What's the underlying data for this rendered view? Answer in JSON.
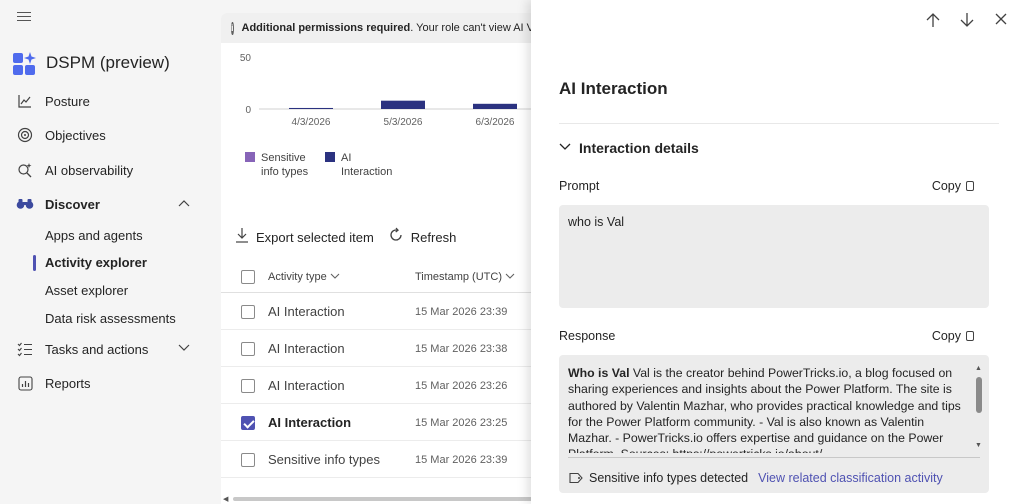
{
  "app": {
    "title": "DSPM (preview)",
    "brand_color": "#4f52b2"
  },
  "nav": {
    "items": [
      {
        "label": "Posture",
        "icon": "trend-chart-icon"
      },
      {
        "label": "Objectives",
        "icon": "target-icon"
      },
      {
        "label": "AI observability",
        "icon": "search-sparkle-icon"
      },
      {
        "label": "Discover",
        "icon": "binoculars-icon"
      },
      {
        "label": "Tasks and actions",
        "icon": "task-list-icon"
      },
      {
        "label": "Reports",
        "icon": "report-icon"
      }
    ],
    "discover_children": [
      "Apps and agents",
      "Activity explorer",
      "Asset explorer",
      "Data risk assessments"
    ],
    "active_child": "Activity explorer"
  },
  "banner": {
    "bold": "Additional permissions required",
    "text": ". Your role can't view AI Visi"
  },
  "chart_data": {
    "type": "bar",
    "categories": [
      "4/3/2026",
      "5/3/2026",
      "6/3/2026"
    ],
    "series": [
      {
        "name": "Sensitive info types",
        "color": "#8764b8",
        "values": [
          0,
          0,
          0
        ]
      },
      {
        "name": "AI Interaction",
        "color": "#2b3280",
        "values": [
          1,
          8,
          5
        ]
      }
    ],
    "yticks": [
      0,
      50
    ],
    "ylim": [
      0,
      50
    ]
  },
  "toolbar": {
    "export_label": "Export selected item",
    "refresh_label": "Refresh"
  },
  "table": {
    "col_type": "Activity type",
    "col_ts": "Timestamp (UTC)",
    "rows": [
      {
        "type": "AI Interaction",
        "ts": "15 Mar 2026 23:39",
        "checked": false
      },
      {
        "type": "AI Interaction",
        "ts": "15 Mar 2026 23:38",
        "checked": false
      },
      {
        "type": "AI Interaction",
        "ts": "15 Mar 2026 23:26",
        "checked": false
      },
      {
        "type": "AI Interaction",
        "ts": "15 Mar 2026 23:25",
        "checked": true
      },
      {
        "type": "Sensitive info types",
        "ts": "15 Mar 2026 23:39",
        "checked": false
      }
    ]
  },
  "panel": {
    "title": "AI Interaction",
    "section": "Interaction details",
    "prompt_label": "Prompt",
    "copy_label": "Copy",
    "prompt_value": "who is Val",
    "response_label": "Response",
    "response_bold": "Who is Val",
    "response_text": " Val is the creator behind PowerTricks.io, a blog focused on sharing experiences and insights about the Power Platform. The site is authored by Valentin Mazhar, who provides practical knowledge and tips for the Power Platform community. - Val is also known as Valentin Mazhar. - PowerTricks.io offers expertise and guidance on the Power Platform. Sources: https://powertricks.io/about/",
    "detected_label": "Sensitive info types detected",
    "link_label": "View related classification activity"
  }
}
